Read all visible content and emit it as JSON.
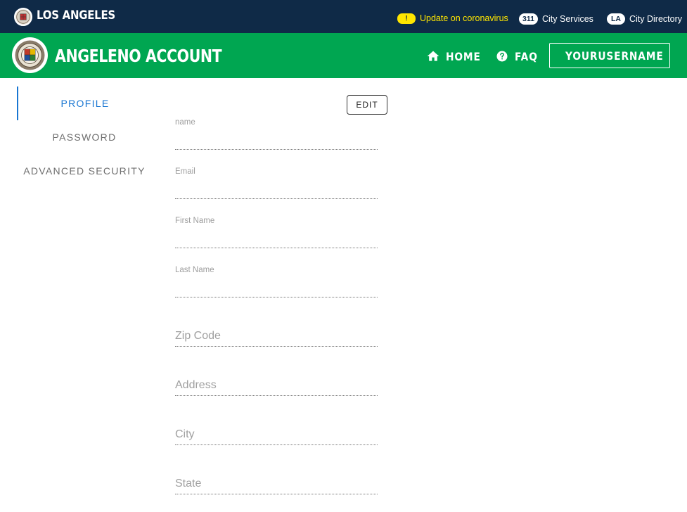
{
  "citybar": {
    "city_name": "LOS ANGELES",
    "alert_badge": "!",
    "alert_link": "Update on coronavirus",
    "services_badge": "311",
    "services_link": "City Services",
    "directory_badge": "LA",
    "directory_link": "City Directory"
  },
  "appbar": {
    "title": "ANGELENO ACCOUNT",
    "nav": {
      "home": "HOME",
      "faq": "FAQ",
      "user": "YOURUSERNAME"
    }
  },
  "sidebar": {
    "tabs": [
      {
        "label": "PROFILE",
        "active": true
      },
      {
        "label": "PASSWORD",
        "active": false
      },
      {
        "label": "ADVANCED SECURITY",
        "active": false
      }
    ]
  },
  "profile": {
    "edit_label": "EDIT",
    "fields": [
      {
        "label": "name",
        "value": "",
        "placeholder": ""
      },
      {
        "label": "Email",
        "value": "",
        "placeholder": ""
      },
      {
        "label": "First Name",
        "value": "",
        "placeholder": ""
      },
      {
        "label": "Last Name",
        "value": "",
        "placeholder": ""
      },
      {
        "label": "",
        "value": "",
        "placeholder": "Zip Code"
      },
      {
        "label": "",
        "value": "",
        "placeholder": "Address"
      },
      {
        "label": "",
        "value": "",
        "placeholder": "City"
      },
      {
        "label": "",
        "value": "",
        "placeholder": "State"
      }
    ]
  },
  "colors": {
    "citybar_bg": "#0f2a47",
    "appbar_bg": "#00a651",
    "alert_yellow": "#ffe600",
    "active_tab": "#1976d2"
  },
  "icons": {
    "home": "home-icon",
    "faq": "help-circle-icon",
    "user": "person-icon",
    "seal": "city-seal-icon"
  }
}
